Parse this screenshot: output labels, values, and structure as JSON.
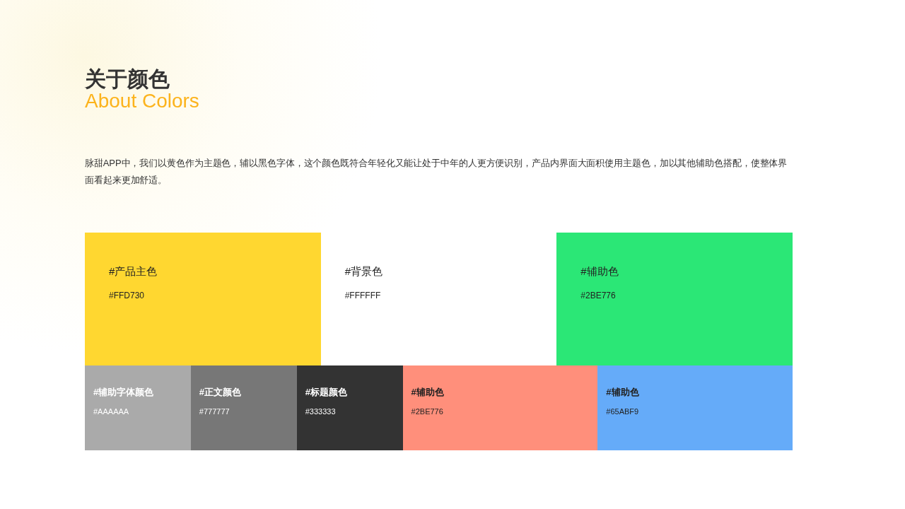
{
  "heading": {
    "title": "关于颜色",
    "subtitle": "About Colors"
  },
  "description": "脉甜APP中，我们以黄色作为主题色，辅以黑色字体，这个颜色既符合年轻化又能让处于中年的人更方便识别，产品内界面大面积使用主题色，加以其他辅助色搭配，使整体界面看起来更加舒适。",
  "main_swatches": [
    {
      "name": "#产品主色",
      "code": "#FFD730",
      "color": "#ffd730"
    },
    {
      "name": "#背景色",
      "code": "#FFFFFF",
      "color": "#ffffff"
    },
    {
      "name": "#辅助色",
      "code": "#2BE776",
      "color": "#2be776"
    }
  ],
  "minor_swatches": [
    {
      "name": "#辅助字体颜色",
      "code": "#AAAAAA",
      "color": "#aaaaaa",
      "kind": "light"
    },
    {
      "name": "#正文颜色",
      "code": "#777777",
      "color": "#777777",
      "kind": "light"
    },
    {
      "name": "#标题颜色",
      "code": "#333333",
      "color": "#333333",
      "kind": "light"
    },
    {
      "name": "#辅助色",
      "code": "#2BE776",
      "color": "#ff8f7b",
      "kind": "dark"
    },
    {
      "name": "#辅助色",
      "code": "#65ABF9",
      "color": "#65abf9",
      "kind": "dark"
    }
  ]
}
